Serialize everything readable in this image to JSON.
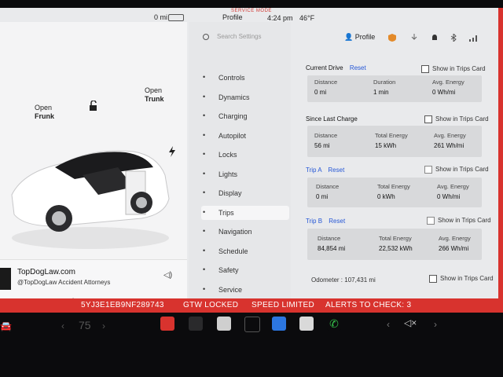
{
  "topbar": {
    "odometer": "0 mi",
    "mode": "SERVICE MODE",
    "profile": "Profile",
    "time": "4:24 pm",
    "temperature": "46°F"
  },
  "left": {
    "frunk_label_1": "Open",
    "frunk_label_2": "Frunk",
    "trunk_label_1": "Open",
    "trunk_label_2": "Trunk",
    "media": {
      "title": "TopDogLaw.com",
      "subtitle": "@TopDogLaw Accident Attorneys"
    }
  },
  "settings": {
    "search_placeholder": "Search Settings",
    "profile": "Profile",
    "menu": [
      {
        "label": "Controls",
        "icon": "toggle-icon"
      },
      {
        "label": "Dynamics",
        "icon": "car-icon"
      },
      {
        "label": "Charging",
        "icon": "bolt-icon"
      },
      {
        "label": "Autopilot",
        "icon": "steering-icon"
      },
      {
        "label": "Locks",
        "icon": "lock-icon"
      },
      {
        "label": "Lights",
        "icon": "sun-icon"
      },
      {
        "label": "Display",
        "icon": "display-icon"
      },
      {
        "label": "Trips",
        "icon": "route-icon",
        "active": true
      },
      {
        "label": "Navigation",
        "icon": "arrow-icon"
      },
      {
        "label": "Schedule",
        "icon": "clock-icon"
      },
      {
        "label": "Safety",
        "icon": "shield-icon"
      },
      {
        "label": "Service",
        "icon": "wrench-icon"
      }
    ]
  },
  "trips": {
    "reset": "Reset",
    "show_in_trips_card": "Show in Trips Card",
    "current_drive": {
      "title": "Current Drive",
      "cells": [
        {
          "label": "Distance",
          "value": "0 mi"
        },
        {
          "label": "Duration",
          "value": "1 min"
        },
        {
          "label": "Avg. Energy",
          "value": "0 Wh/mi"
        }
      ]
    },
    "since_last_charge": {
      "title": "Since Last Charge",
      "cells": [
        {
          "label": "Distance",
          "value": "56 mi"
        },
        {
          "label": "Total Energy",
          "value": "15 kWh"
        },
        {
          "label": "Avg. Energy",
          "value": "261 Wh/mi"
        }
      ]
    },
    "trip_a": {
      "title": "Trip A",
      "cells": [
        {
          "label": "Distance",
          "value": "0 mi"
        },
        {
          "label": "Total Energy",
          "value": "0 kWh"
        },
        {
          "label": "Avg. Energy",
          "value": "0 Wh/mi"
        }
      ]
    },
    "trip_b": {
      "title": "Trip B",
      "cells": [
        {
          "label": "Distance",
          "value": "84,854 mi"
        },
        {
          "label": "Total Energy",
          "value": "22,532 kWh"
        },
        {
          "label": "Avg. Energy",
          "value": "266 Wh/mi"
        }
      ]
    },
    "odometer": "Odometer : 107,431 mi"
  },
  "alerts": {
    "vin": "5YJ3E1EB9NF289743",
    "gtw": "GTW LOCKED",
    "speed": "SPEED LIMITED",
    "alerts": "ALERTS TO CHECK: 3"
  },
  "dock": {
    "temp": "75"
  },
  "colors": {
    "accent_blue": "#2557d6",
    "alert_red": "#d8332e"
  }
}
